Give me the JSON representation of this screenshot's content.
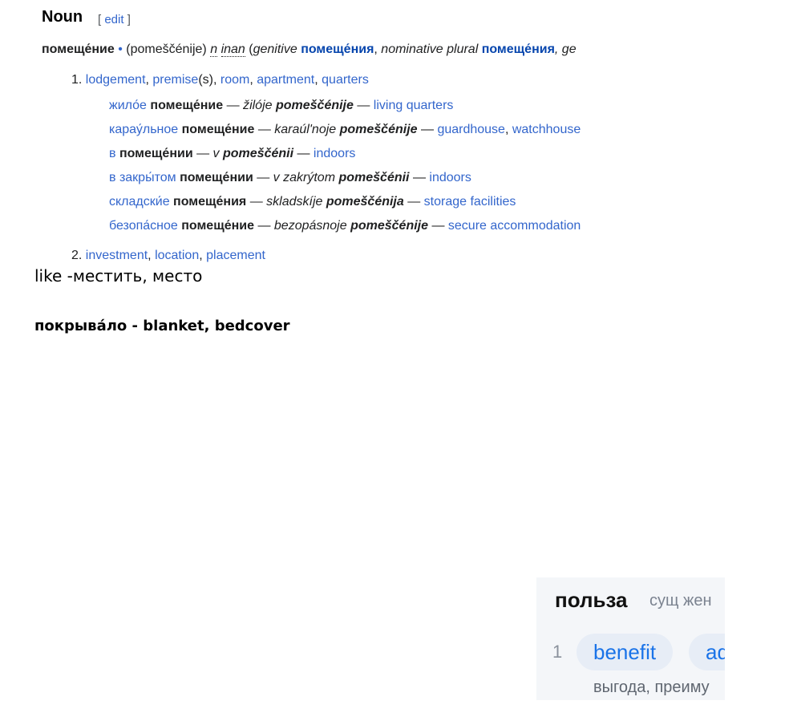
{
  "wiktionary": {
    "section_title": "Noun",
    "edit_open": "[ ",
    "edit_link": "edit",
    "edit_close": " ]",
    "headword": "помеще́ние",
    "bullet": " • ",
    "translit": "(pomeščénije) ",
    "gender": "n",
    "animacy": "inan",
    "paren_open": " (",
    "genitive_label": "genitive",
    "genitive_form": "помеще́ния",
    "comma": ", ",
    "plural_label": "nominative plural",
    "plural_form": "помеще́ния",
    "trailing": ", ge",
    "senses": [
      {
        "number": "1.",
        "glosses": [
          "lodgement",
          "premise",
          "(s), ",
          "room",
          "apartment",
          "quarters"
        ],
        "examples": [
          {
            "pre": "жило́е",
            "head": "помеще́ние",
            "dash1": " — ",
            "tr_pre": "žilóje ",
            "tr_head": "pomeščénije",
            "dash2": " — ",
            "gloss": "living quarters"
          },
          {
            "pre": "карау́льное",
            "head": "помеще́ние",
            "dash1": " — ",
            "tr_pre": "karaúl'noje ",
            "tr_head": "pomeščénije",
            "dash2": " — ",
            "gloss": "guardhouse",
            "gloss2": "watchhouse"
          },
          {
            "pre": "в",
            "head": "помеще́нии",
            "dash1": " — ",
            "tr_pre": "v ",
            "tr_head": "pomeščénii",
            "dash2": " — ",
            "gloss": "indoors"
          },
          {
            "pre": "в закры́том",
            "head": "помеще́нии",
            "dash1": " — ",
            "tr_pre": "v zakrýtom ",
            "tr_head": "pomeščénii",
            "dash2": " — ",
            "gloss": "indoors"
          },
          {
            "pre": "складски́е",
            "head": "помеще́ния",
            "dash1": " — ",
            "tr_pre": "skladskíje ",
            "tr_head": "pomeščénija",
            "dash2": " — ",
            "gloss": "storage facilities"
          },
          {
            "pre": "безопа́сное",
            "head": "помеще́ние",
            "dash1": " — ",
            "tr_pre": "bezopásnoje ",
            "tr_head": "pomeščénije",
            "dash2": " — ",
            "gloss": "secure accommodation"
          }
        ]
      },
      {
        "number": "2.",
        "glosses": [
          "investment",
          "location",
          "placement"
        ]
      }
    ]
  },
  "notes": {
    "line1": "like -местить, место",
    "line2": "покрыва́ло - blanket, bedcover"
  },
  "card": {
    "word": "польза",
    "pos": "сущ жен",
    "sense_number": "1",
    "translation_1": "benefit",
    "translation_2": "ad",
    "synonyms": "выгода, преиму"
  }
}
